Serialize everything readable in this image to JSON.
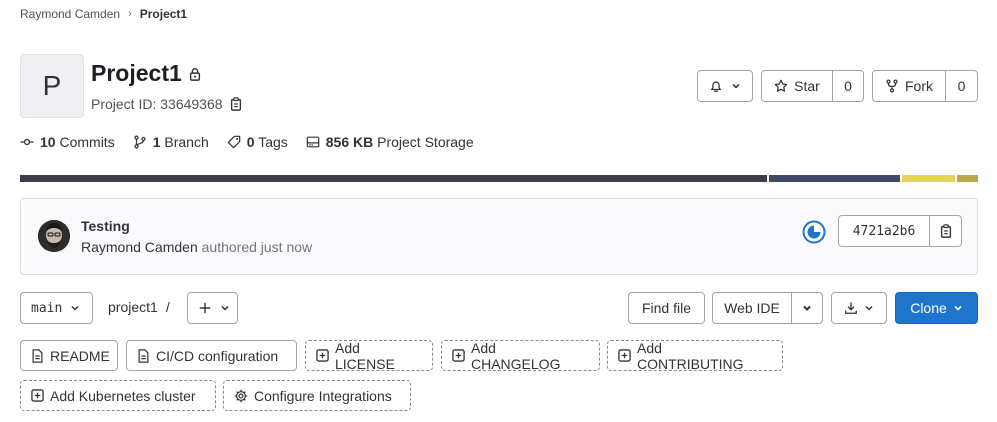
{
  "breadcrumb": {
    "parent": "Raymond Camden",
    "separator": "›",
    "current": "Project1"
  },
  "project": {
    "avatar_letter": "P",
    "name": "Project1",
    "id_label": "Project ID: 33649368"
  },
  "actions": {
    "star_label": "Star",
    "star_count": "0",
    "fork_label": "Fork",
    "fork_count": "0"
  },
  "stats": {
    "commits_count": "10",
    "commits_label": "Commits",
    "branch_count": "1",
    "branch_label": "Branch",
    "tags_count": "0",
    "tags_label": "Tags",
    "storage_size": "856 KB",
    "storage_label": "Project Storage"
  },
  "language_bar": [
    {
      "fraction": 0.78,
      "color": "#3d3d4a"
    },
    {
      "fraction": 0.137,
      "color": "#3c4a66"
    },
    {
      "fraction": 0.055,
      "color": "#e5d35b"
    },
    {
      "fraction": 0.022,
      "color": "#bba64a"
    }
  ],
  "commit": {
    "title": "Testing",
    "author": "Raymond Camden",
    "authored_text": "authored just now",
    "sha": "4721a2b6"
  },
  "toolbar": {
    "branch": "main",
    "path": "project1",
    "path_sep": "/",
    "find_file": "Find file",
    "web_ide": "Web IDE",
    "clone": "Clone"
  },
  "quick_actions": [
    {
      "label": "README"
    },
    {
      "label": "CI/CD configuration"
    },
    {
      "label": "Add LICENSE"
    },
    {
      "label": "Add CHANGELOG"
    },
    {
      "label": "Add CONTRIBUTING"
    },
    {
      "label": "Add Kubernetes cluster"
    },
    {
      "label": "Configure Integrations"
    }
  ],
  "colors": {
    "accent": "#1f75cb",
    "pipeline": "#1f75cb"
  }
}
